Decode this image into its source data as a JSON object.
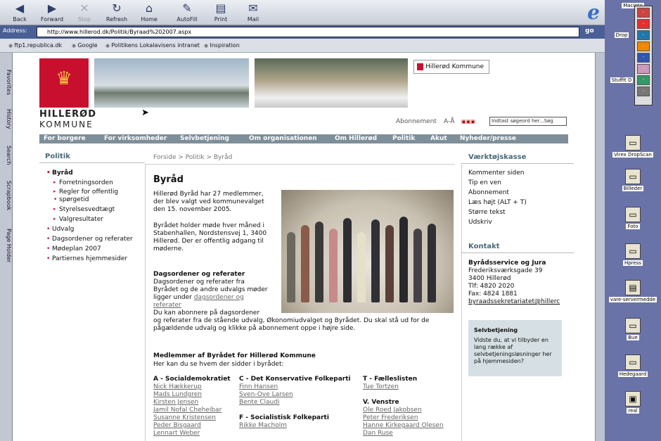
{
  "toolbar": {
    "back": "Back",
    "forward": "Forward",
    "stop": "Stop",
    "refresh": "Refresh",
    "home": "Home",
    "autofill": "AutoFill",
    "print": "Print",
    "mail": "Mail"
  },
  "address": {
    "label": "Address:",
    "url": "http://www.hillerod.dk/Politik/Byraad%202007.aspx",
    "go": "go"
  },
  "favorites": [
    "ftp1.republica.dk",
    "Google",
    "Politikens Lokalavisens intranet",
    "Inspiration"
  ],
  "sidetabs": [
    "Favorites",
    "History",
    "Search",
    "Scrapbook",
    "Page Holder"
  ],
  "desktop": {
    "top_label": "Macinto",
    "items": [
      "Drop",
      "Stuffit D",
      "Virex DropScan",
      "Billeder",
      "Foto",
      "Hpress",
      "vare-servermedde",
      "Bue",
      "Hedegaard",
      "real"
    ]
  },
  "site": {
    "logo_line1": "HILLERØD",
    "logo_line2": "KOMMUNE",
    "badge": "Hillerød Kommune",
    "abonnement": "Abonnement",
    "font_size": "A-Å",
    "search_placeholder": "Indtast søgeord her...",
    "search_go": "Søg",
    "nav": [
      "For borgere",
      "For virksomheder",
      "Selvbetjening",
      "Om organisationen",
      "Om Hillerød",
      "Politik",
      "Akut",
      "Nyheder/presse"
    ]
  },
  "left": {
    "heading": "Politik",
    "items": [
      "Byråd",
      "Forretningsorden",
      "Regler for offentlig",
      "spørgetid",
      "Styrelsesvedtægt",
      "Valgresultater",
      "Udvalg",
      "Dagsordener og referater",
      "Mødeplan 2007",
      "Partiernes hjemmesider"
    ]
  },
  "center": {
    "breadcrumb": "Forside > Politik > Byråd",
    "title": "Byråd",
    "intro": [
      "Hillerød Byråd har 27 medlemmer,",
      "der blev valgt ved kommunevalget",
      "den 15. november 2005."
    ],
    "meeting": [
      "Byrådet holder møde hver måned i",
      "Stabenhallen, Nordstensvej 1, 3400",
      "Hillerød. Der er offentlig adgang til",
      "møderne."
    ],
    "dags_title": "Dagsordener og referater",
    "dags": [
      "Dagsordener og referater fra",
      "Byrådet og de andre udvalgs møder",
      "ligger under"
    ],
    "dags_link1": "dagsordener og",
    "dags_link2": "referater",
    "abon": [
      "Du kan abonnere på dagsordener",
      "og referater fra de stående udvalg, Økonomiudvalget og Byrådet. Du skal stå ud for de",
      "pågældende udvalg og klikke på abonnement oppe i højre side."
    ],
    "members_title": "Medlemmer af Byrådet for Hillerød Kommune",
    "members_sub": "Her kan du se hvem der sidder i byrådet:",
    "parties": [
      {
        "name": "A - Socialdemokratiet",
        "members": [
          "Nick Hækkerup",
          "Mads Lundgren",
          "Kirsten Jensen",
          "Jamil Nofal Cheheibar",
          "Susanne Kristensen",
          "Peder Bisgaard",
          "Lennart Weber"
        ]
      },
      {
        "name": "C - Det Konservative Folkeparti",
        "members": [
          "Finn Hansen",
          "Sven-Ove Larsen",
          "Bente Claudi"
        ]
      },
      {
        "name": "F - Socialistisk Folkeparti",
        "members": [
          "Rikke Macholm"
        ]
      },
      {
        "name": "T - Fælleslisten",
        "members": [
          "Tue Tortzen"
        ]
      },
      {
        "name": "V. Venstre",
        "members": [
          "Ole Roed Jakobsen",
          "Peter Frederiksen",
          "Hanne Kirkegaard Olesen",
          "Dan Ruse"
        ]
      }
    ]
  },
  "right": {
    "tools_heading": "Værktøjskasse",
    "tools": [
      "Kommenter siden",
      "Tip en ven",
      "Abonnement",
      "Læs højt (ALT + T)",
      "Større tekst",
      "Udskriv"
    ],
    "contact_heading": "Kontakt",
    "contact": [
      "Byrådsservice og Jura",
      "Frederiksværksgade 39",
      "3400 Hillerød",
      "Tlf: 4820 2020",
      "Fax: 4824 1881",
      "byraadssekretariatet@hillerc"
    ],
    "selv_title": "Selvbetjening",
    "selv_text": "Vidste du, at vi tilbyder en lang række af selvbetjeningsløsninger her på hjemmesiden?"
  },
  "colors": {
    "brand_red": "#c8102e",
    "nav_bg": "#7e8f9a",
    "heading": "#4a6a78",
    "browser_blue": "#4a5f95"
  }
}
